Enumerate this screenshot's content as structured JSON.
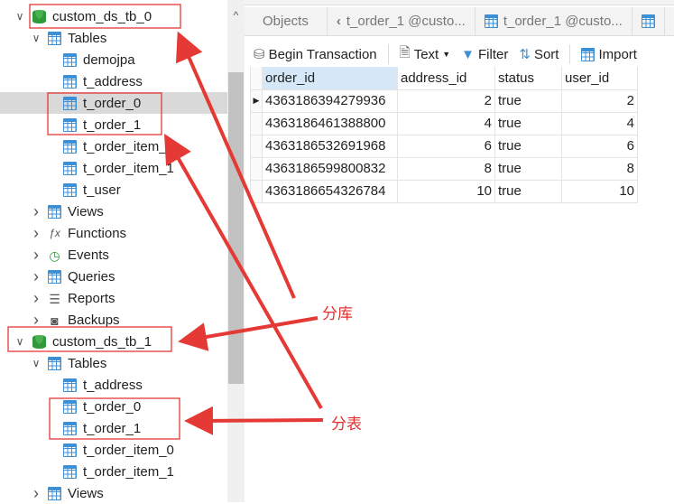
{
  "tree": [
    {
      "label": "custom_ds_tb_0",
      "level": 0,
      "icon": "database-icon",
      "chev": "v"
    },
    {
      "label": "Tables",
      "level": 1,
      "icon": "table-icon",
      "chev": "v"
    },
    {
      "label": "demojpa",
      "level": 2,
      "icon": "table-icon"
    },
    {
      "label": "t_address",
      "level": 2,
      "icon": "table-icon"
    },
    {
      "label": "t_order_0",
      "level": 2,
      "icon": "table-icon",
      "selected": true
    },
    {
      "label": "t_order_1",
      "level": 2,
      "icon": "table-icon"
    },
    {
      "label": "t_order_item_0",
      "level": 2,
      "icon": "table-icon"
    },
    {
      "label": "t_order_item_1",
      "level": 2,
      "icon": "table-icon"
    },
    {
      "label": "t_user",
      "level": 2,
      "icon": "table-icon"
    },
    {
      "label": "Views",
      "level": 1,
      "icon": "views-icon",
      "chev": ">"
    },
    {
      "label": "Functions",
      "level": 1,
      "icon": "function-icon",
      "chev": ">"
    },
    {
      "label": "Events",
      "level": 1,
      "icon": "clock-icon",
      "chev": ">"
    },
    {
      "label": "Queries",
      "level": 1,
      "icon": "query-icon",
      "chev": ">"
    },
    {
      "label": "Reports",
      "level": 1,
      "icon": "report-icon",
      "chev": ">"
    },
    {
      "label": "Backups",
      "level": 1,
      "icon": "backup-icon",
      "chev": ">"
    },
    {
      "label": "custom_ds_tb_1",
      "level": 0,
      "icon": "database-icon",
      "chev": "v"
    },
    {
      "label": "Tables",
      "level": 1,
      "icon": "table-icon",
      "chev": "v"
    },
    {
      "label": "t_address",
      "level": 2,
      "icon": "table-icon"
    },
    {
      "label": "t_order_0",
      "level": 2,
      "icon": "table-icon"
    },
    {
      "label": "t_order_1",
      "level": 2,
      "icon": "table-icon"
    },
    {
      "label": "t_order_item_0",
      "level": 2,
      "icon": "table-icon"
    },
    {
      "label": "t_order_item_1",
      "level": 2,
      "icon": "table-icon"
    },
    {
      "label": "Views",
      "level": 1,
      "icon": "views-icon",
      "chev": ">"
    }
  ],
  "tabs": {
    "objects": "Objects",
    "tab1": "t_order_1 @custo...",
    "tab2": "t_order_1 @custo..."
  },
  "toolbar": {
    "begin": "Begin Transaction",
    "text": "Text",
    "filter": "Filter",
    "sort": "Sort",
    "import": "Import"
  },
  "grid": {
    "columns": [
      "order_id",
      "address_id",
      "status",
      "user_id"
    ],
    "rows": [
      [
        "4363186394279936",
        "2",
        "true",
        "2"
      ],
      [
        "4363186461388800",
        "4",
        "true",
        "4"
      ],
      [
        "4363186532691968",
        "6",
        "true",
        "6"
      ],
      [
        "4363186599800832",
        "8",
        "true",
        "8"
      ],
      [
        "4363186654326784",
        "10",
        "true",
        "10"
      ]
    ]
  },
  "annotations": {
    "db_split": "分库",
    "table_split": "分表"
  },
  "colors": {
    "annotation": "#e53935",
    "accent": "#3d8fd6"
  }
}
